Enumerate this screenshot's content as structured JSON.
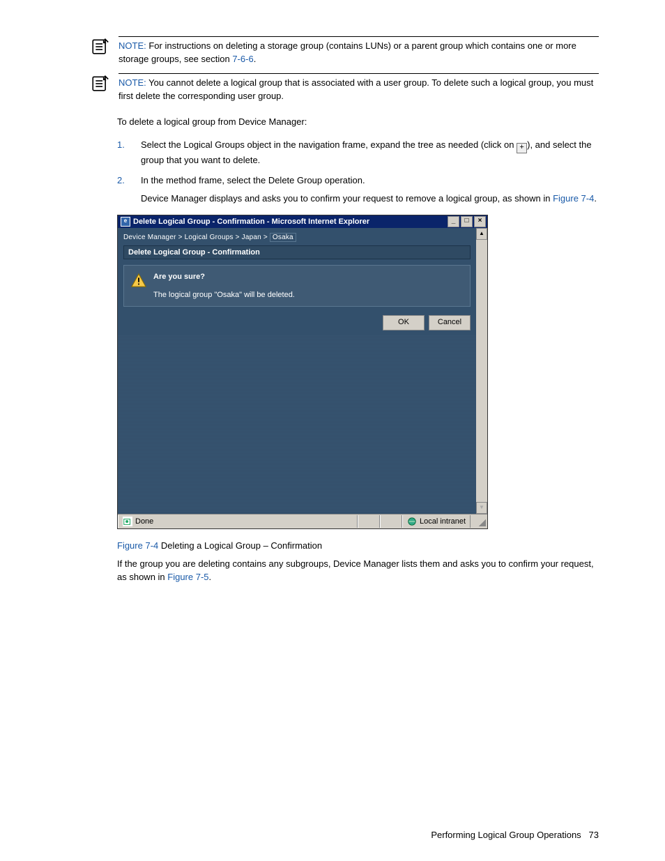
{
  "notes": {
    "label": "NOTE:",
    "n1_a": "For instructions on deleting a storage group (contains LUNs) or a parent group which contains one or more storage groups, see section ",
    "n1_link": "7-6-6",
    "n1_b": ".",
    "n2": "You cannot delete a logical group that is associated with a user group. To delete such a logical group, you must first delete the corresponding user group."
  },
  "intro": "To delete a logical group from Device Manager:",
  "steps": {
    "s1a": "Select the Logical Groups object in the navigation frame, expand the tree as needed (click on ",
    "s1b": "), and select the group that you want to delete.",
    "s2": "In the method frame, select the Delete Group operation.",
    "s2sub_a": "Device Manager displays and asks you to confirm your request to remove a logical group, as shown in ",
    "s2sub_link": "Figure 7-4",
    "s2sub_b": "."
  },
  "plus": "+",
  "ie": {
    "title": "Delete Logical Group - Confirmation - Microsoft Internet Explorer",
    "min": "_",
    "max": "□",
    "close": "×",
    "sup": "▲",
    "sdown": "▼",
    "bread_a": "Device Manager > Logical Groups > Japan > ",
    "bread_box": "Osaka",
    "subtitle": "Delete Logical Group - Confirmation",
    "q": "Are you sure?",
    "p": "The logical group \"Osaka\" will be deleted.",
    "ok": "OK",
    "cancel": "Cancel",
    "done": "Done",
    "zone": "Local intranet"
  },
  "caption": {
    "fig": "Figure 7-4",
    "text": " Deleting a Logical Group – Confirmation",
    "p_a": "If the group you are deleting contains any subgroups, Device Manager lists them and asks you to confirm your request, as shown in ",
    "p_link": "Figure 7-5",
    "p_b": "."
  },
  "footer": {
    "text": "Performing Logical Group Operations",
    "page": "73"
  }
}
